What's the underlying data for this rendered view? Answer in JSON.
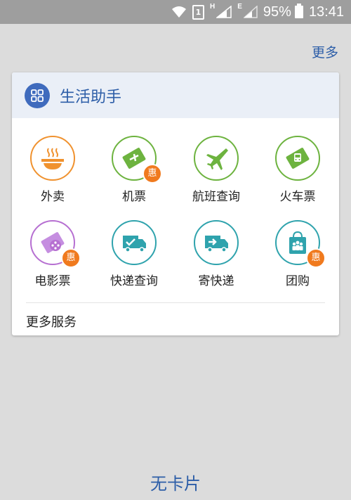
{
  "status_bar": {
    "network_type_1": "H",
    "network_type_2": "E",
    "sim_label": "1",
    "battery": "95%",
    "time": "13:41"
  },
  "top": {
    "more_label": "更多"
  },
  "card": {
    "title": "生活助手",
    "accent_color": "#3f6bbd",
    "badge_label": "惠",
    "items": [
      {
        "label": "外卖",
        "icon": "food-bowl-icon",
        "color": "#f0922f",
        "badge": false
      },
      {
        "label": "机票",
        "icon": "flight-ticket-icon",
        "color": "#6db33f",
        "badge": true
      },
      {
        "label": "航班查询",
        "icon": "airplane-icon",
        "color": "#6db33f",
        "badge": false
      },
      {
        "label": "火车票",
        "icon": "train-ticket-icon",
        "color": "#6db33f",
        "badge": false
      },
      {
        "label": "电影票",
        "icon": "movie-ticket-icon",
        "color": "#b66fd1",
        "badge": true
      },
      {
        "label": "快递查询",
        "icon": "delivery-truck-check-icon",
        "color": "#2fa3ad",
        "badge": false
      },
      {
        "label": "寄快递",
        "icon": "delivery-truck-send-icon",
        "color": "#2fa3ad",
        "badge": false
      },
      {
        "label": "团购",
        "icon": "shopping-bag-icon",
        "color": "#2fa3ad",
        "badge": true
      }
    ],
    "more_services": "更多服务"
  },
  "footer": {
    "empty_text": "无卡片"
  }
}
